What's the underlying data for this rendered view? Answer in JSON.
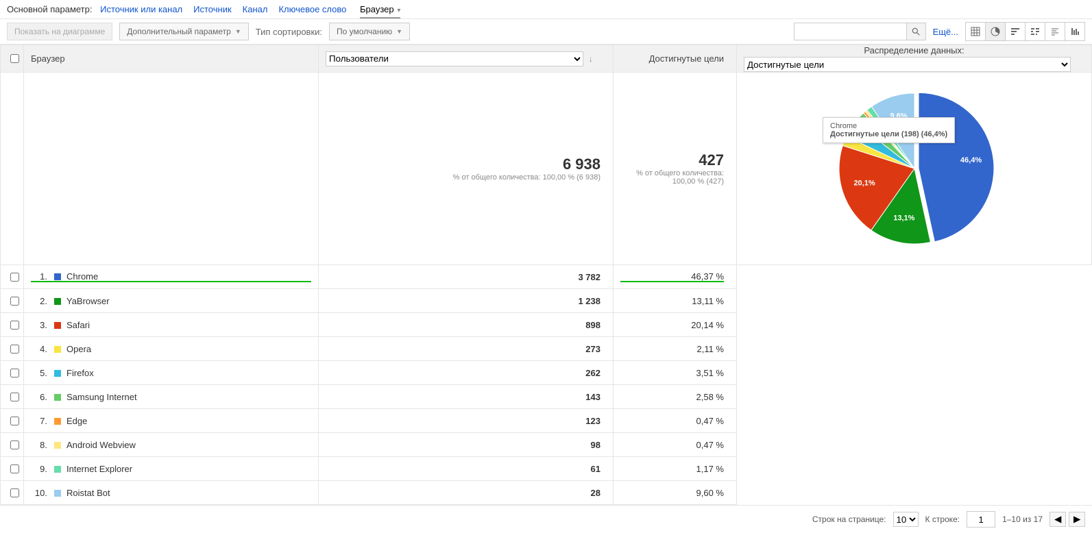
{
  "topParam": {
    "label": "Основной параметр:",
    "links": [
      "Источник или канал",
      "Источник",
      "Канал",
      "Ключевое слово"
    ],
    "active": "Браузер"
  },
  "toolbar": {
    "plotBtn": "Показать на диаграмме",
    "secondaryParam": "Дополнительный параметр",
    "sortTypeLabel": "Тип сортировки:",
    "sortTypeValue": "По умолчанию",
    "more": "Ещё..."
  },
  "headers": {
    "browser": "Браузер",
    "usersSelect": "Пользователи",
    "goals": "Достигнутые цели",
    "chartTitle": "Распределение данных:",
    "chartSelect": "Достигнутые цели"
  },
  "totals": {
    "usersBig": "6 938",
    "usersSub": "% от общего количества: 100,00 % (6 938)",
    "goalsBig": "427",
    "goalsSub": "% от общего количества: 100,00 % (427)"
  },
  "rows": [
    {
      "idx": "1.",
      "color": "#3366cc",
      "name": "Chrome",
      "users": "3 782",
      "goals": "46,37 %",
      "highlight": true
    },
    {
      "idx": "2.",
      "color": "#109618",
      "name": "YaBrowser",
      "users": "1 238",
      "goals": "13,11 %"
    },
    {
      "idx": "3.",
      "color": "#dc3912",
      "name": "Safari",
      "users": "898",
      "goals": "20,14 %"
    },
    {
      "idx": "4.",
      "color": "#f9e542",
      "name": "Opera",
      "users": "273",
      "goals": "2,11 %"
    },
    {
      "idx": "5.",
      "color": "#33bbdd",
      "name": "Firefox",
      "users": "262",
      "goals": "3,51 %"
    },
    {
      "idx": "6.",
      "color": "#66cc66",
      "name": "Samsung Internet",
      "users": "143",
      "goals": "2,58 %"
    },
    {
      "idx": "7.",
      "color": "#ff9933",
      "name": "Edge",
      "users": "123",
      "goals": "0,47 %"
    },
    {
      "idx": "8.",
      "color": "#ffe680",
      "name": "Android Webview",
      "users": "98",
      "goals": "0,47 %"
    },
    {
      "idx": "9.",
      "color": "#66ddaa",
      "name": "Internet Explorer",
      "users": "61",
      "goals": "1,17 %"
    },
    {
      "idx": "10.",
      "color": "#99ccee",
      "name": "Roistat Bot",
      "users": "28",
      "goals": "9,60 %"
    }
  ],
  "chart_data": {
    "type": "pie",
    "title": "Распределение данных: Достигнутые цели",
    "series": [
      {
        "name": "Chrome",
        "value": 46.4,
        "color": "#3366cc",
        "label": "46,4%"
      },
      {
        "name": "YaBrowser",
        "value": 13.1,
        "color": "#109618",
        "label": "13,1%"
      },
      {
        "name": "Safari",
        "value": 20.1,
        "color": "#dc3912",
        "label": "20,1%"
      },
      {
        "name": "Opera",
        "value": 2.1,
        "color": "#f9e542"
      },
      {
        "name": "Firefox",
        "value": 3.5,
        "color": "#33bbdd"
      },
      {
        "name": "Samsung Internet",
        "value": 2.6,
        "color": "#66cc66"
      },
      {
        "name": "Edge",
        "value": 0.5,
        "color": "#ff9933"
      },
      {
        "name": "Android Webview",
        "value": 0.5,
        "color": "#ffe680"
      },
      {
        "name": "Internet Explorer",
        "value": 1.2,
        "color": "#66ddaa"
      },
      {
        "name": "Roistat Bot",
        "value": 9.6,
        "color": "#99ccee",
        "label": "9,6%"
      }
    ],
    "tooltip": {
      "title": "Chrome",
      "line": "Достигнутые цели (198) (46,4%)"
    }
  },
  "footer": {
    "rowsPerPageLabel": "Строк на странице:",
    "rowsPerPageValue": "10",
    "goToLabel": "К строке:",
    "goToValue": "1",
    "range": "1–10 из 17"
  }
}
